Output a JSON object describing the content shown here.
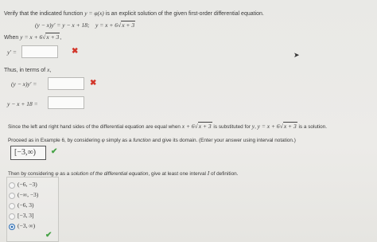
{
  "intro": {
    "text1": "Verify that the indicated function ",
    "fn": "y = φ(x)",
    "text2": " is an explicit solution of the given first-order differential equation."
  },
  "equation": {
    "ode": "(y − x)y′ = y − x + 18;",
    "solution_prefix": "y = x + 6",
    "solution_radicand": "x + 3"
  },
  "when": {
    "prefix": "When ",
    "expr": "y = x + 6",
    "radicand": "x + 3",
    "suffix": ","
  },
  "yprime": {
    "label": "y′ =",
    "value": "",
    "status": "incorrect"
  },
  "thus": {
    "label": "Thus, in terms of ",
    "var": "x",
    "suffix": ","
  },
  "lhs": {
    "label": "(y − x)y′ =",
    "value": "",
    "status": "incorrect"
  },
  "rhs": {
    "label": "y − x + 18 =",
    "value": "",
    "status": "unanswered"
  },
  "since": {
    "text1": "Since the left and right hand sides of the differential equation are equal when ",
    "expr": "x + 6",
    "radicand": "x + 3",
    "text2": " is substituted for ",
    "text3": "y",
    "text4": ", ",
    "sol": "y = x + 6",
    "sol_radicand": "x + 3",
    "text5": " is a solution."
  },
  "proceed": {
    "text": "Proceed as in Example 6, by considering ",
    "phi": "φ",
    "text2": " simply as a ",
    "em": "function",
    "text3": " and give its domain. (Enter your answer using interval notation.)"
  },
  "domain_answer": {
    "value": "[−3,∞)",
    "status": "correct"
  },
  "then": {
    "text": "Then by considering ",
    "phi": "φ",
    "text2": " as a ",
    "em": "solution of the differential equation",
    "text3": ", give at least one interval ",
    "I": "I",
    "text4": " of definition."
  },
  "options": [
    {
      "label": "(−6, −3)",
      "selected": false
    },
    {
      "label": "(−∞, −3)",
      "selected": false
    },
    {
      "label": "(−6, 3)",
      "selected": false
    },
    {
      "label": "[−3, 3]",
      "selected": false
    },
    {
      "label": "(−3, ∞)",
      "selected": true
    }
  ],
  "options_status": "correct",
  "colors": {
    "incorrect": "#d2362a",
    "correct": "#47a347",
    "radio_selected": "#2f6fb4"
  }
}
